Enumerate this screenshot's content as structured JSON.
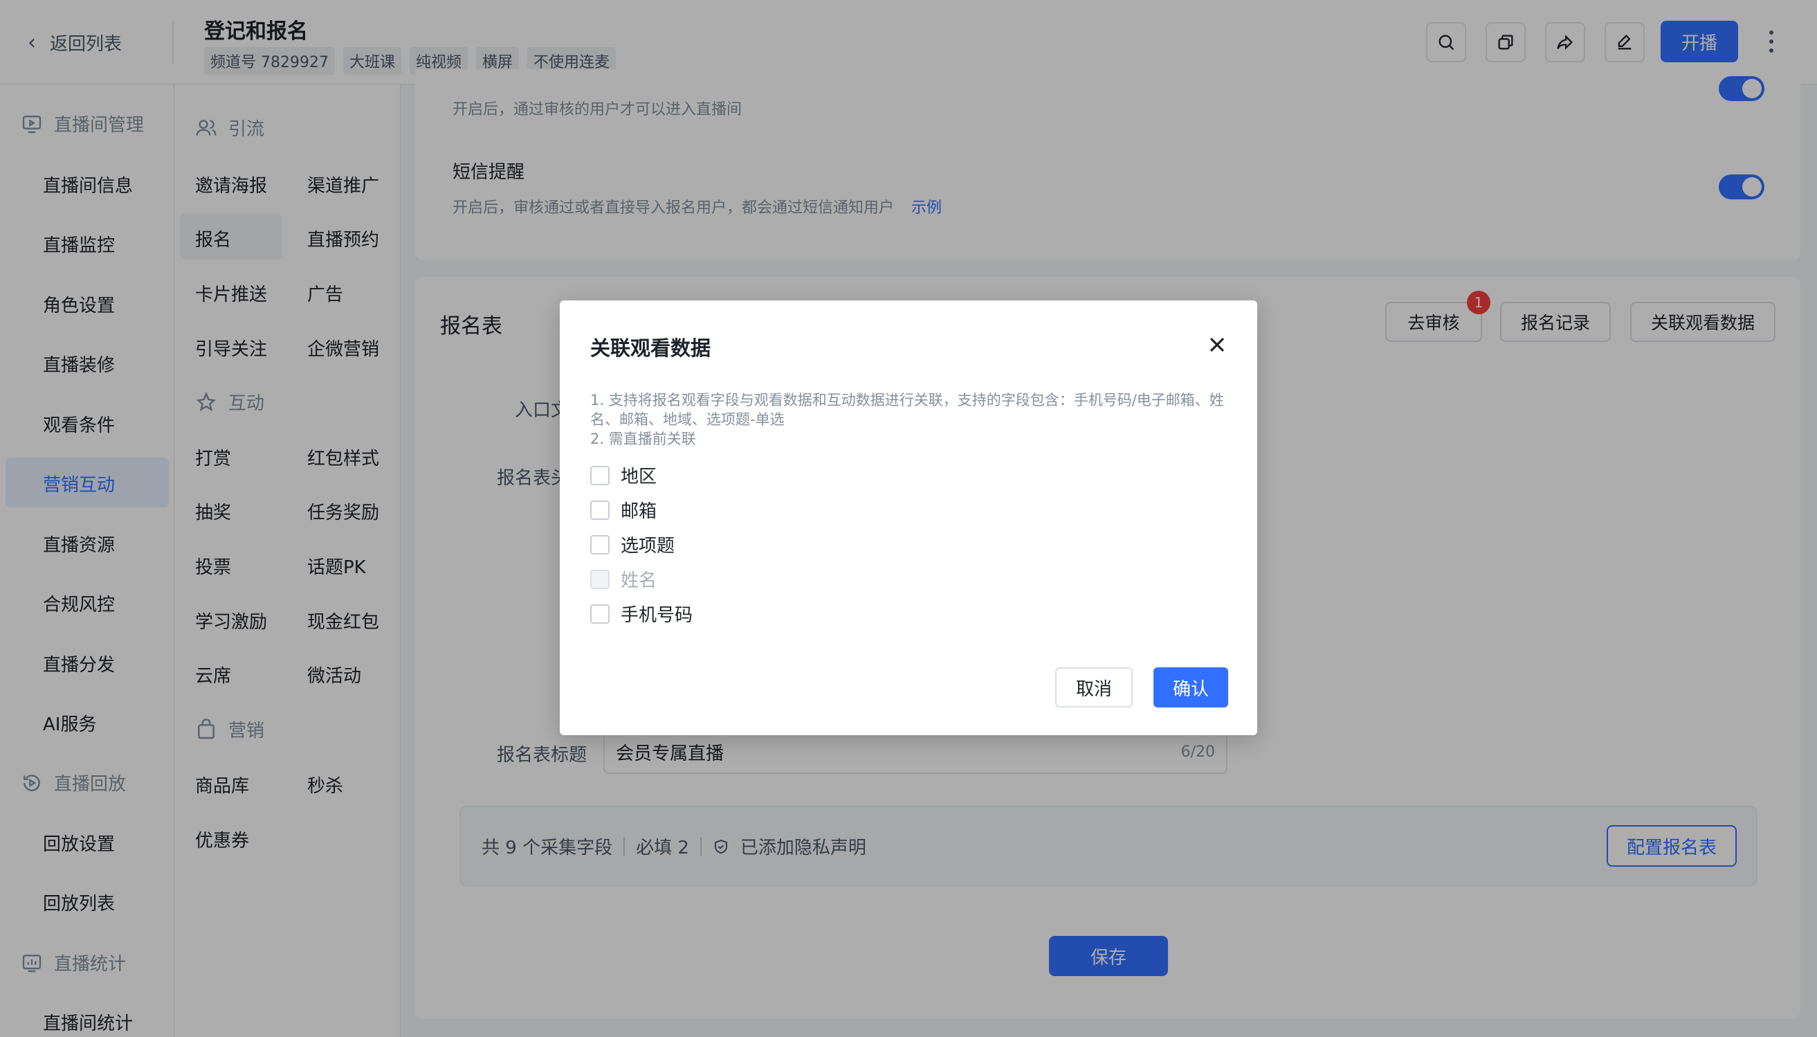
{
  "header": {
    "back_label": "返回列表",
    "title": "登记和报名",
    "tags": [
      "频道号 7829927",
      "大班课",
      "纯视频",
      "横屏",
      "不使用连麦"
    ],
    "live_button": "开播",
    "icons": [
      "search-icon",
      "copy-icon",
      "share-icon",
      "edit-icon",
      "more-icon"
    ]
  },
  "sidebar": {
    "groups": {
      "room_management": "直播间管理",
      "playback": "直播回放",
      "stats": "直播统计"
    },
    "items": {
      "room_info": "直播间信息",
      "monitor": "直播监控",
      "roles": "角色设置",
      "decor": "直播装修",
      "watch_conditions": "观看条件",
      "marketing": "营销互动",
      "resources": "直播资源",
      "compliance": "合规风控",
      "distribution": "直播分发",
      "ai": "AI服务",
      "playback_settings": "回放设置",
      "playback_list": "回放列表",
      "room_stats": "直播间统计"
    },
    "active_item": "营销互动"
  },
  "submenu": {
    "groups": {
      "traffic": "引流",
      "interaction": "互动",
      "sales": "营销"
    },
    "items": {
      "invite_poster": "邀请海报",
      "channel_promo": "渠道推广",
      "signup": "报名",
      "live_reserve": "直播预约",
      "card_push": "卡片推送",
      "ads": "广告",
      "follow_guide": "引导关注",
      "wecom_marketing": "企微营销",
      "reward": "打赏",
      "redpacket_style": "红包样式",
      "lottery": "抽奖",
      "task_reward": "任务奖励",
      "vote": "投票",
      "topic_pk": "话题PK",
      "study_incentive": "学习激励",
      "cash_redpacket": "现金红包",
      "cloud_seat": "云席",
      "micro_activity": "微活动",
      "product_library": "商品库",
      "flash_sale": "秒杀",
      "coupon": "优惠券"
    },
    "active_item": "报名"
  },
  "main": {
    "audit_desc": "开启后，通过审核的用户才可以进入直播间",
    "sms_title": "短信提醒",
    "sms_desc": "开启后，审核通过或者直接导入报名用户，都会通过短信通知用户",
    "sms_example": "示例",
    "form_section_title": "报名表",
    "buttons": {
      "review": "去审核",
      "records": "报名记录",
      "link_watch": "关联观看数据"
    },
    "review_badge": "1",
    "entry_label": "入口文",
    "header_label": "报名表头",
    "form_title_label": "报名表标题",
    "form_title_value": "会员专属直播",
    "form_title_count": "6/20",
    "summary": {
      "fields": "共 9 个采集字段",
      "required": "必填 2",
      "privacy": "已添加隐私声明"
    },
    "configure_button": "配置报名表",
    "save_button": "保存"
  },
  "modal": {
    "title": "关联观看数据",
    "desc_line1": "1. 支持将报名观看字段与观看数据和互动数据进行关联，支持的字段包含：手机号码/电子邮箱、姓名、邮箱、地域、选项题-单选",
    "desc_line2": "2. 需直播前关联",
    "options": [
      "地区",
      "邮箱",
      "选项题",
      "姓名",
      "手机号码"
    ],
    "cancel": "取消",
    "confirm": "确认"
  },
  "colors": {
    "accent": "#3370ff",
    "badge": "#f53f3f",
    "overlay": "rgba(0,0,0,0.32)"
  }
}
